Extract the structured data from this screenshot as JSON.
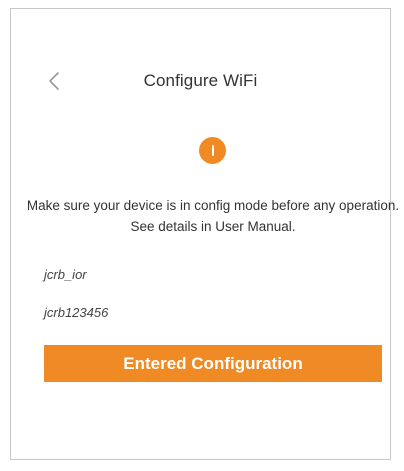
{
  "header": {
    "title": "Configure WiFi",
    "back_icon": "chevron-left-icon"
  },
  "notice": {
    "icon": "warning-icon",
    "icon_color": "#f08a24",
    "text": "Make sure your device is in config mode before any operation. See details in User Manual."
  },
  "credentials": {
    "ssid": "jcrb_ior",
    "password": "jcrb123456"
  },
  "actions": {
    "primary_label": "Entered Configuration",
    "primary_color": "#f08a24"
  }
}
